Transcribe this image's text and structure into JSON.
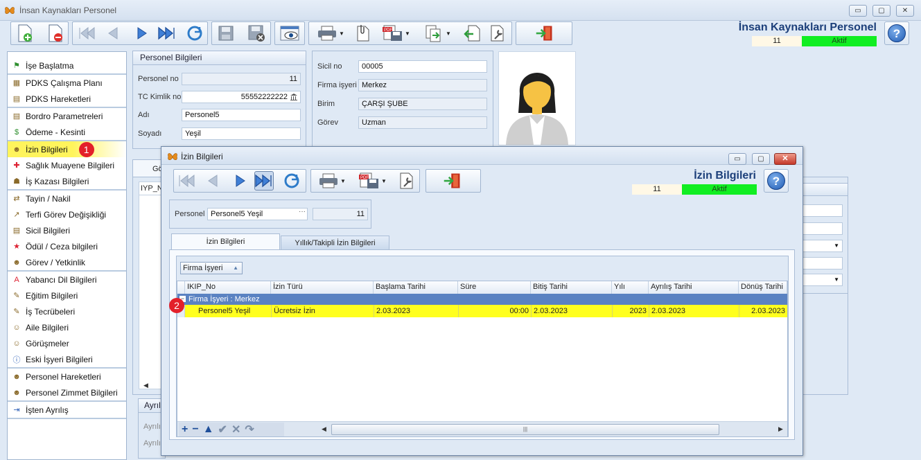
{
  "window": {
    "title": "İnsan Kaynakları Personel",
    "controls": {
      "minimize": "▭",
      "maximize": "▢",
      "close": "✕"
    }
  },
  "header": {
    "title": "İnsan Kaynakları Personel",
    "record_no": "11",
    "status": "Aktif",
    "help": "?"
  },
  "nav": {
    "groups": [
      [
        {
          "label": "İşe Başlatma",
          "icon": "flag-icon"
        }
      ],
      [
        {
          "label": "PDKS Çalışma Planı",
          "icon": "calendar-icon"
        },
        {
          "label": "PDKS Hareketleri",
          "icon": "timesheet-icon"
        }
      ],
      [
        {
          "label": "Bordro Parametreleri",
          "icon": "document-icon"
        },
        {
          "label": "Ödeme - Kesinti",
          "icon": "money-icon"
        }
      ],
      [
        {
          "label": "İzin Bilgileri",
          "icon": "person-leave-icon",
          "selected": true,
          "badge": "1"
        },
        {
          "label": "Sağlık Muayene Bilgileri",
          "icon": "health-icon"
        },
        {
          "label": "İş Kazası Bilgileri",
          "icon": "accident-icon"
        }
      ],
      [
        {
          "label": "Tayin / Nakil",
          "icon": "transfer-icon"
        },
        {
          "label": "Terfi Görev Değişikliği",
          "icon": "promotion-icon"
        },
        {
          "label": "Sicil Bilgileri",
          "icon": "record-icon"
        },
        {
          "label": "Ödül / Ceza bilgileri",
          "icon": "award-icon"
        },
        {
          "label": "Görev / Yetkinlik",
          "icon": "role-icon"
        }
      ],
      [
        {
          "label": "Yabancı Dil Bilgileri",
          "icon": "language-icon"
        },
        {
          "label": "Eğitim Bilgileri",
          "icon": "education-icon"
        },
        {
          "label": "İş Tecrübeleri",
          "icon": "experience-icon"
        },
        {
          "label": "Aile Bilgileri",
          "icon": "family-icon"
        },
        {
          "label": "Görüşmeler",
          "icon": "meeting-icon"
        },
        {
          "label": "Eski İşyeri Bilgileri",
          "icon": "info-icon"
        }
      ],
      [
        {
          "label": "Personel Hareketleri",
          "icon": "movement-icon"
        },
        {
          "label": "Personel Zimmet Bilgileri",
          "icon": "asset-icon"
        }
      ],
      [
        {
          "label": "İşten Ayrılış",
          "icon": "exit-icon"
        }
      ]
    ]
  },
  "personel_panel": {
    "title": "Personel Bilgileri",
    "personel_no_label": "Personel no",
    "personel_no": "11",
    "tc_label": "TC Kimlik no",
    "tc": "55552222222",
    "ad_label": "Adı",
    "ad": "Personel5",
    "soyad_label": "Soyadı",
    "soyad": "Yeşil"
  },
  "sicil_panel": {
    "sicil_label": "Sicil no",
    "sicil": "00005",
    "firma_label": "Firma işyeri",
    "firma": "Merkez",
    "birim_label": "Birim",
    "birim": "ÇARŞI ŞUBE",
    "gorev_label": "Görev",
    "gorev": "Uzman"
  },
  "background": {
    "tab_partial": "Gö",
    "grid_header_partial": "IYP_N",
    "bottom_header_partial": "Ayrıl",
    "bottom_label_1": "Ayrılı",
    "bottom_label_2": "Ayrılı"
  },
  "dialog": {
    "title": "İzin Bilgileri",
    "header_title": "İzin Bilgileri",
    "record_no": "11",
    "status": "Aktif",
    "help": "?",
    "controls": {
      "minimize": "▭",
      "maximize": "▢",
      "close": "✕"
    },
    "personel_label": "Personel",
    "personel_value": "Personel5 Yeşil",
    "personel_ellipsis": "···",
    "personel_no": "11",
    "tabs": [
      "İzin Bilgileri",
      "Yıllık/Takipli İzin Bilgileri"
    ],
    "group_by_chip": "Firma İşyeri",
    "columns": [
      "IKIP_No",
      "İzin Türü",
      "Başlama Tarihi",
      "Süre",
      "Bitiş Tarihi",
      "Yılı",
      "Ayrılış Tarihi",
      "Dönüş Tarihi"
    ],
    "group_row": "Firma İşyeri : Merkez",
    "row": {
      "ikip_no": "Personel5 Yeşil",
      "izin_turu": "Ücretsiz İzin",
      "baslama": "2.03.2023",
      "sure": "00:00",
      "bitis": "2.03.2023",
      "yili": "2023",
      "ayrilis": "2.03.2023",
      "donus": "2.03.2023"
    },
    "row_badge": "2",
    "nav_buttons": [
      "+",
      "−",
      "▲",
      "✔",
      "✕",
      "↷"
    ],
    "scrollbar_grip": "|||"
  }
}
